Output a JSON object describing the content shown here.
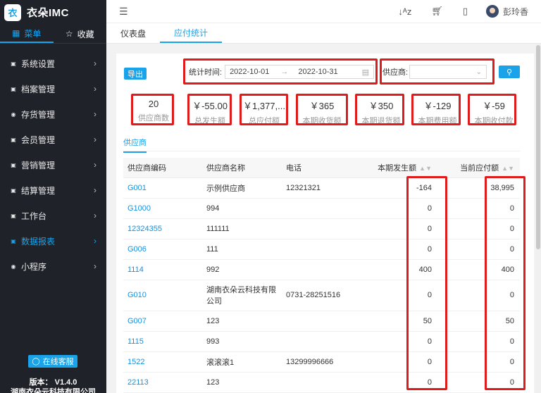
{
  "brand": {
    "logo": "衣",
    "title": "衣朵IMC"
  },
  "side_tabs": [
    {
      "label": "菜单",
      "icon": "grid-icon"
    },
    {
      "label": "收藏",
      "icon": "star-icon"
    }
  ],
  "menu": [
    {
      "label": "系统设置"
    },
    {
      "label": "档案管理"
    },
    {
      "label": "存货管理"
    },
    {
      "label": "会员管理"
    },
    {
      "label": "营销管理"
    },
    {
      "label": "结算管理"
    },
    {
      "label": "工作台"
    },
    {
      "label": "数据报表",
      "active": true
    },
    {
      "label": "小程序"
    }
  ],
  "customer_service": "在线客服",
  "version": "版本： V1.4.0",
  "company": "湖南衣朵云科技有限公司",
  "header": {
    "user": "彭玲香"
  },
  "tabs": [
    {
      "label": "仪表盘"
    },
    {
      "label": "应付统计",
      "active": true
    }
  ],
  "toolbar": {
    "export_label": "导出",
    "date_label": "统计时间:",
    "date_start": "2022-10-01",
    "date_end": "2022-10-31",
    "supplier_label": "供应商:"
  },
  "stats": [
    {
      "value": "20",
      "label": "供应商数"
    },
    {
      "value": "￥-55.00",
      "label": "总发生额"
    },
    {
      "value": "￥1,377,...",
      "label": "总应付额"
    },
    {
      "value": "￥365",
      "label": "本期收货额"
    },
    {
      "value": "￥350",
      "label": "本期退货额"
    },
    {
      "value": "￥-129",
      "label": "本期费用额"
    },
    {
      "value": "￥-59",
      "label": "本期收付款"
    }
  ],
  "subtab": "供应商",
  "table": {
    "headers": [
      "供应商编码",
      "供应商名称",
      "电话",
      "本期发生额",
      "当前应付额"
    ],
    "rows": [
      {
        "code": "G001",
        "name": "示例供应商",
        "phone": "12321321",
        "occurred": "-164",
        "payable": "38,995"
      },
      {
        "code": "G1000",
        "name": "994",
        "phone": "",
        "occurred": "0",
        "payable": "0"
      },
      {
        "code": "12324355",
        "name": "111111",
        "phone": "",
        "occurred": "0",
        "payable": "0"
      },
      {
        "code": "G006",
        "name": "111",
        "phone": "",
        "occurred": "0",
        "payable": "0"
      },
      {
        "code": "1114",
        "name": "992",
        "phone": "",
        "occurred": "400",
        "payable": "400"
      },
      {
        "code": "G010",
        "name": "湖南衣朵云科技有限公司",
        "phone": "0731-28251516",
        "occurred": "0",
        "payable": "0"
      },
      {
        "code": "G007",
        "name": "123",
        "phone": "",
        "occurred": "50",
        "payable": "50"
      },
      {
        "code": "1115",
        "name": "993",
        "phone": "",
        "occurred": "0",
        "payable": "0"
      },
      {
        "code": "1522",
        "name": "滚滚滚1",
        "phone": "13299996666",
        "occurred": "0",
        "payable": "0"
      },
      {
        "code": "22113",
        "name": "123",
        "phone": "",
        "occurred": "0",
        "payable": "0"
      }
    ]
  },
  "colors": {
    "accent": "#1aa3e8",
    "sidebar": "#20222a",
    "highlight": "#e01b1b"
  }
}
